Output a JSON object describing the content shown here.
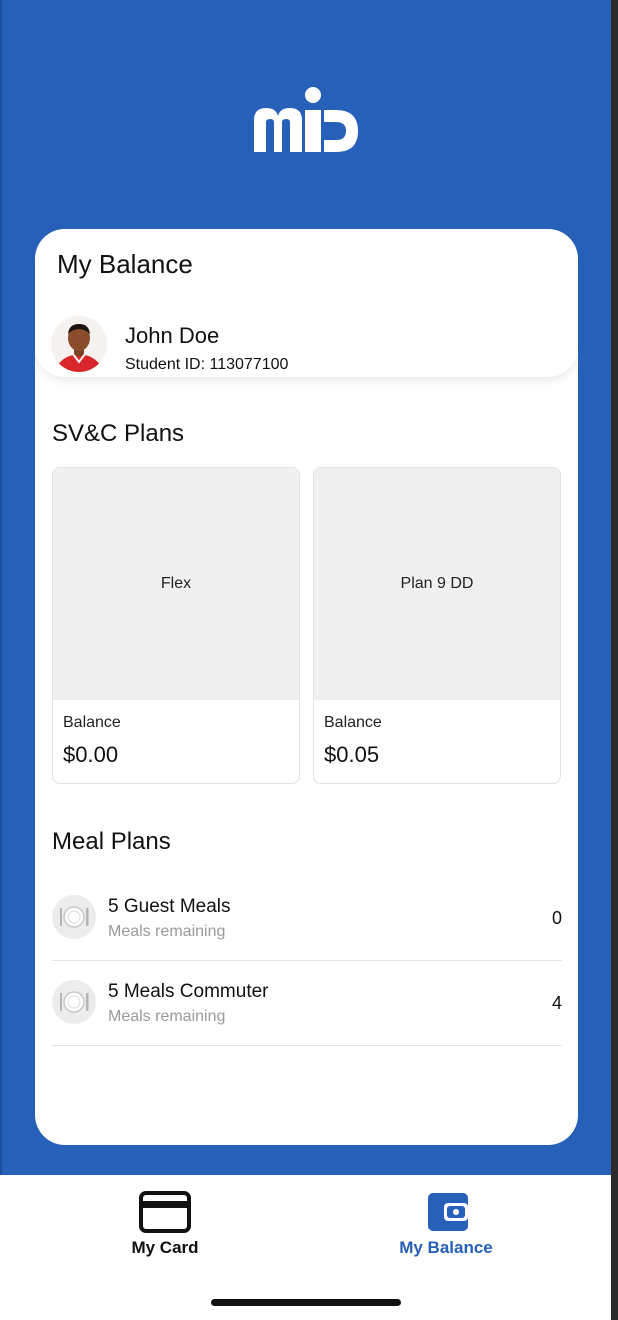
{
  "brand": {
    "logo_alt": "mid logo",
    "primary_color": "#2660b8"
  },
  "balance_card": {
    "title": "My Balance",
    "user": {
      "name": "John Doe",
      "student_id": "Student ID: 113077100"
    }
  },
  "sv_plans": {
    "title": "SV&C Plans",
    "plans": [
      {
        "name": "Flex",
        "balance_label": "Balance",
        "balance": "$0.00"
      },
      {
        "name": "Plan 9 DD",
        "balance_label": "Balance",
        "balance": "$0.05"
      }
    ]
  },
  "meal_plans": {
    "title": "Meal Plans",
    "items": [
      {
        "name": "5 Guest Meals",
        "subtitle": "Meals remaining",
        "count": "0",
        "icon": "plate-cutlery-icon"
      },
      {
        "name": "5 Meals Commuter",
        "subtitle": "Meals remaining",
        "count": "4",
        "icon": "plate-cutlery-icon"
      }
    ]
  },
  "bottom_nav": {
    "tabs": [
      {
        "label": "My Card",
        "icon": "credit-card-icon",
        "active": false
      },
      {
        "label": "My Balance",
        "icon": "wallet-icon",
        "active": true
      }
    ]
  }
}
